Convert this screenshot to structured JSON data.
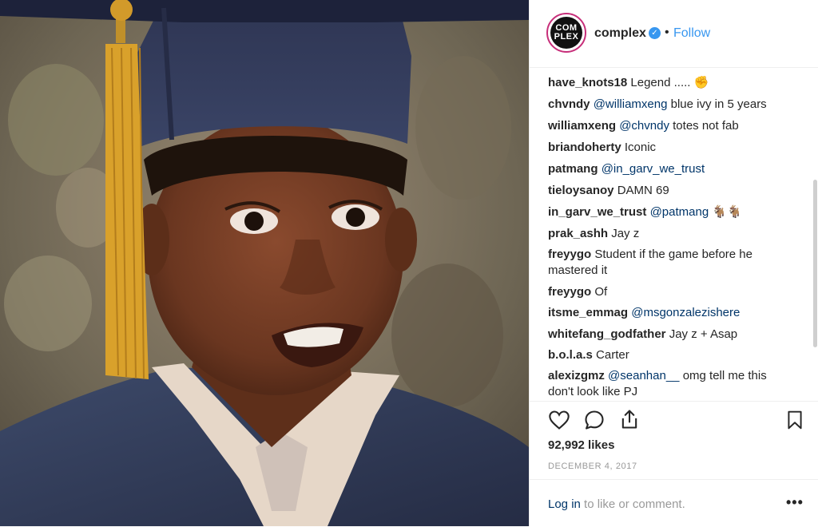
{
  "post": {
    "account": "complex",
    "avatar_text_line1": "COM",
    "avatar_text_line2": "PLEX",
    "verified_icon": "verified-check-icon",
    "separator": "•",
    "follow_label": "Follow"
  },
  "comments": [
    {
      "user": "have_knots18",
      "text": "Legend .....",
      "emoji": "✊"
    },
    {
      "user": "chvndy",
      "mention": "@williamxeng",
      "text": "blue ivy in 5 years"
    },
    {
      "user": "williamxeng",
      "mention": "@chvndy",
      "text": "totes not fab"
    },
    {
      "user": "briandoherty",
      "text": "Iconic"
    },
    {
      "user": "patmang",
      "mention": "@in_garv_we_trust",
      "text": ""
    },
    {
      "user": "tieloysanoy",
      "text": "DAMN 69"
    },
    {
      "user": "in_garv_we_trust",
      "mention": "@patmang",
      "text": "",
      "emoji": "🐐🐐"
    },
    {
      "user": "prak_ashh",
      "text": "Jay z"
    },
    {
      "user": "freyygo",
      "text": "Student if the game before he mastered it"
    },
    {
      "user": "freyygo",
      "text": "Of"
    },
    {
      "user": "itsme_emmag",
      "mention": "@msgonzalezishere",
      "text": ""
    },
    {
      "user": "whitefang_godfather",
      "text": "Jay z + Asap"
    },
    {
      "user": "b.o.l.a.s",
      "text": "Carter"
    },
    {
      "user": "alexizgmz",
      "mention": "@seanhan__",
      "text": "omg tell me this don't look like PJ"
    }
  ],
  "actions": {
    "like_icon": "heart-icon",
    "comment_icon": "comment-icon",
    "share_icon": "share-icon",
    "save_icon": "bookmark-icon"
  },
  "likes_text": "92,992 likes",
  "date_text": "DECEMBER 4, 2017",
  "login": {
    "link": "Log in",
    "rest": "to like or comment."
  },
  "more_label": "•••",
  "colors": {
    "link": "#3897f0",
    "mention": "#003569",
    "meta": "#999999"
  }
}
